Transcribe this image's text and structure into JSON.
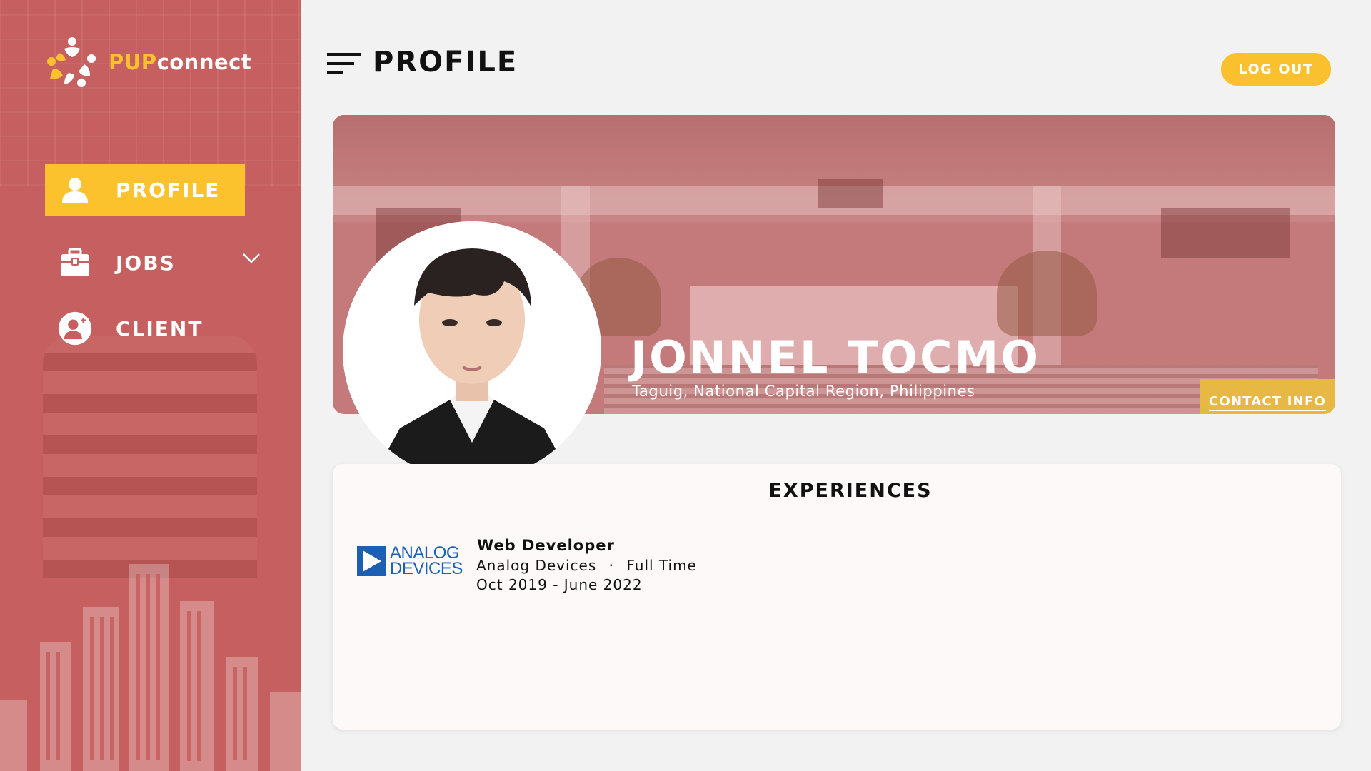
{
  "colors": {
    "sidebar": "#c65f5f",
    "accent": "#fbc02d",
    "background": "#f2f2f2",
    "brand_blue": "#1c5fb3"
  },
  "brand": {
    "prefix": "PUP",
    "suffix": "connect",
    "logo_icon": "people-circle-icon"
  },
  "sidebar": {
    "items": [
      {
        "label": "PROFILE",
        "icon": "user-icon",
        "active": true
      },
      {
        "label": "JOBS",
        "icon": "briefcase-icon",
        "active": false,
        "has_dropdown": true
      },
      {
        "label": "CLIENT",
        "icon": "add-user-icon",
        "active": false
      }
    ]
  },
  "header": {
    "title": "PROFILE",
    "menu_icon": "menu-lines-icon",
    "logout_label": "LOG OUT"
  },
  "profile": {
    "name": "JONNEL TOCMO",
    "location": "Taguig, National Capital Region, Philippines",
    "contact_label": "CONTACT INFO"
  },
  "experiences": {
    "title": "EXPERIENCES",
    "items": [
      {
        "logo_line1": "ANALOG",
        "logo_line2": "DEVICES",
        "role": "Web Developer",
        "company": "Analog Devices",
        "separator": "·",
        "employment_type": "Full Time",
        "dates": "Oct 2019 - June 2022"
      }
    ]
  }
}
